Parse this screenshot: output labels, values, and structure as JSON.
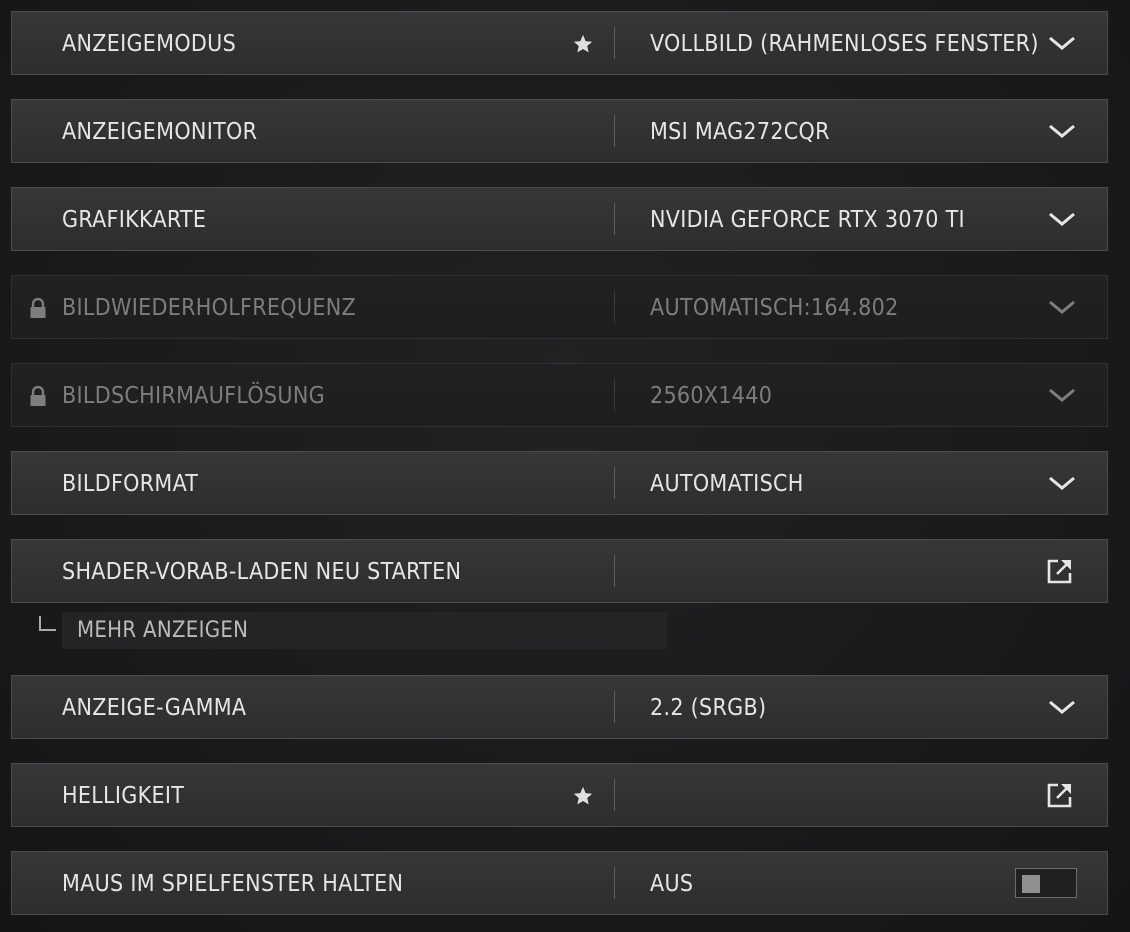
{
  "settings": [
    {
      "label": "ANZEIGEMODUS",
      "value": "VOLLBILD (RAHMENLOSES FENSTER)",
      "control": "dropdown",
      "starred": true,
      "locked": false
    },
    {
      "label": "ANZEIGEMONITOR",
      "value": "MSI MAG272CQR",
      "control": "dropdown",
      "starred": false,
      "locked": false
    },
    {
      "label": "GRAFIKKARTE",
      "value": "NVIDIA GEFORCE RTX 3070 TI",
      "control": "dropdown",
      "starred": false,
      "locked": false
    },
    {
      "label": "BILDWIEDERHOLFREQUENZ",
      "value": "AUTOMATISCH:164.802",
      "control": "dropdown",
      "starred": false,
      "locked": true
    },
    {
      "label": "BILDSCHIRMAUFLÖSUNG",
      "value": "2560X1440",
      "control": "dropdown",
      "starred": false,
      "locked": true
    },
    {
      "label": "BILDFORMAT",
      "value": "AUTOMATISCH",
      "control": "dropdown",
      "starred": false,
      "locked": false
    },
    {
      "label": "SHADER-VORAB-LADEN NEU STARTEN",
      "value": "",
      "control": "external-link",
      "starred": false,
      "locked": false
    },
    {
      "label": "ANZEIGE-GAMMA",
      "value": "2.2 (SRGB)",
      "control": "dropdown",
      "starred": false,
      "locked": false
    },
    {
      "label": "HELLIGKEIT",
      "value": "",
      "control": "external-link",
      "starred": true,
      "locked": false
    },
    {
      "label": "MAUS IM SPIELFENSTER HALTEN",
      "value": "AUS",
      "control": "toggle",
      "starred": false,
      "locked": false,
      "toggle_on": false
    }
  ],
  "more": {
    "label": "MEHR ANZEIGEN"
  },
  "icons": {
    "dropdown": "chevron-down-icon",
    "star": "star-icon",
    "lock": "lock-icon",
    "external": "external-link-icon",
    "branch": "tree-branch-icon"
  },
  "colors": {
    "row_bg": "#303233",
    "row_border": "#4a4c4d",
    "text": "#e6e6e6",
    "text_disabled": "#7b7d7e"
  }
}
